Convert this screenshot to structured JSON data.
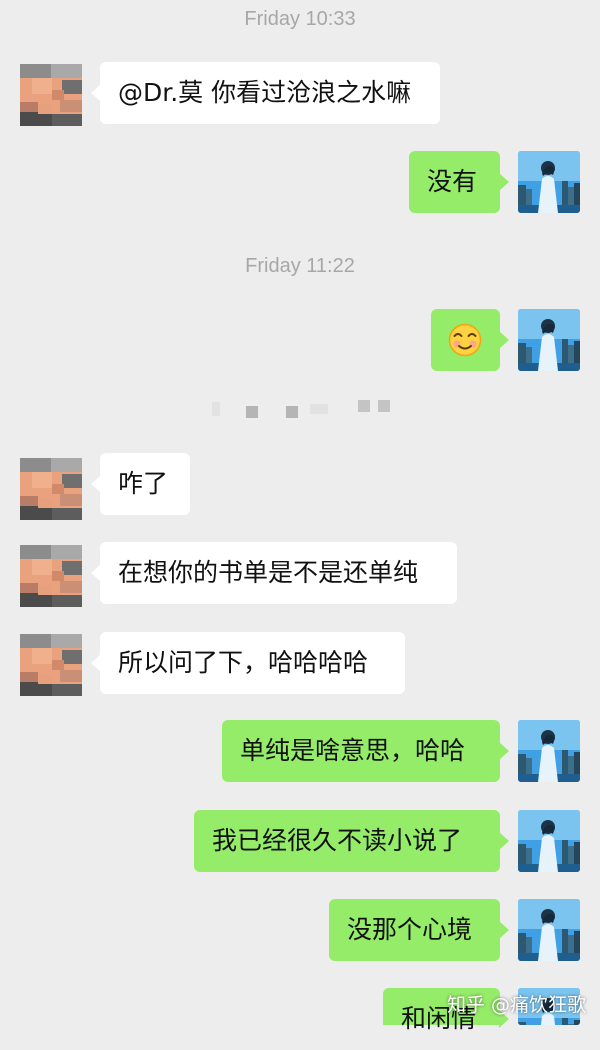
{
  "timestamps": [
    "Friday 10:33",
    "Friday 11:22"
  ],
  "messages": [
    {
      "side": "left",
      "text": "@Dr.莫 你看过沧浪之水嘛"
    },
    {
      "side": "right",
      "text": "没有"
    },
    {
      "side": "right",
      "emoji": "😊"
    },
    {
      "side": "left",
      "text": "咋了"
    },
    {
      "side": "left",
      "text": "在想你的书单是不是还单纯"
    },
    {
      "side": "left",
      "text": "所以问了下，哈哈哈哈"
    },
    {
      "side": "right",
      "text": "单纯是啥意思，哈哈"
    },
    {
      "side": "right",
      "text": "我已经很久不读小说了"
    },
    {
      "side": "right",
      "text": "没那个心境"
    },
    {
      "side": "right",
      "text": "和闲情"
    }
  ],
  "watermark": "知乎 @痛饮狂歌",
  "colors": {
    "background": "#ededed",
    "incoming_bubble": "#ffffff",
    "outgoing_bubble": "#95ec69",
    "timestamp": "#a7a7a7"
  },
  "icons": {
    "incoming_avatar": "pixelated-avatar",
    "outgoing_avatar": "city-skyline-avatar",
    "emoji": "smiling-face-emoji"
  }
}
